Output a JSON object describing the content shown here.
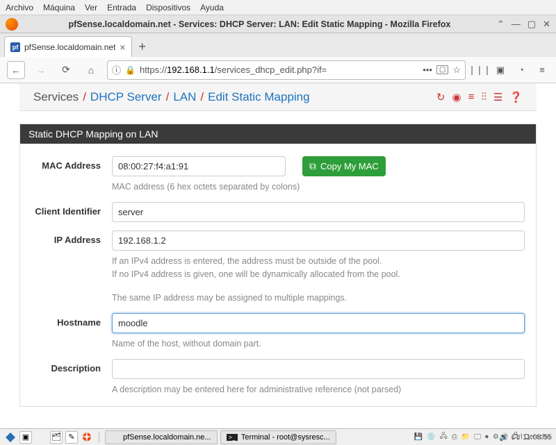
{
  "menubar": [
    "Archivo",
    "Máquina",
    "Ver",
    "Entrada",
    "Dispositivos",
    "Ayuda"
  ],
  "window": {
    "title": "pfSense.localdomain.net - Services: DHCP Server: LAN: Edit Static Mapping - Mozilla Firefox"
  },
  "tab": {
    "label": "pfSense.localdomain.net",
    "favicon": "pf"
  },
  "url": {
    "scheme": "https://",
    "host": "192.168.1.1",
    "path": "/services_dhcp_edit.php?if="
  },
  "breadcrumb": {
    "root": "Services",
    "a": "DHCP Server",
    "b": "LAN",
    "c": "Edit Static Mapping"
  },
  "panel": {
    "title": "Static DHCP Mapping on LAN",
    "mac_label": "MAC Address",
    "mac_value": "08:00:27:f4:a1:91",
    "copy_mac": "Copy My MAC",
    "mac_help": "MAC address (6 hex octets separated by colons)",
    "cid_label": "Client Identifier",
    "cid_value": "server",
    "ip_label": "IP Address",
    "ip_value": "192.168.1.2",
    "ip_help1": "If an IPv4 address is entered, the address must be outside of the pool.",
    "ip_help2": "If no IPv4 address is given, one will be dynamically allocated from the pool.",
    "ip_help3": "The same IP address may be assigned to multiple mappings.",
    "hostname_label": "Hostname",
    "hostname_value": "moodle",
    "hostname_help": "Name of the host, without domain part.",
    "desc_label": "Description",
    "desc_value": "",
    "desc_help": "A description may be entered here for administrative reference (not parsed)"
  },
  "taskbar": {
    "ff": "pfSense.localdomain.ne...",
    "term": "Terminal - root@sysresc...",
    "clock": "11:08:55",
    "kbd": "Ctrl Derecho"
  }
}
